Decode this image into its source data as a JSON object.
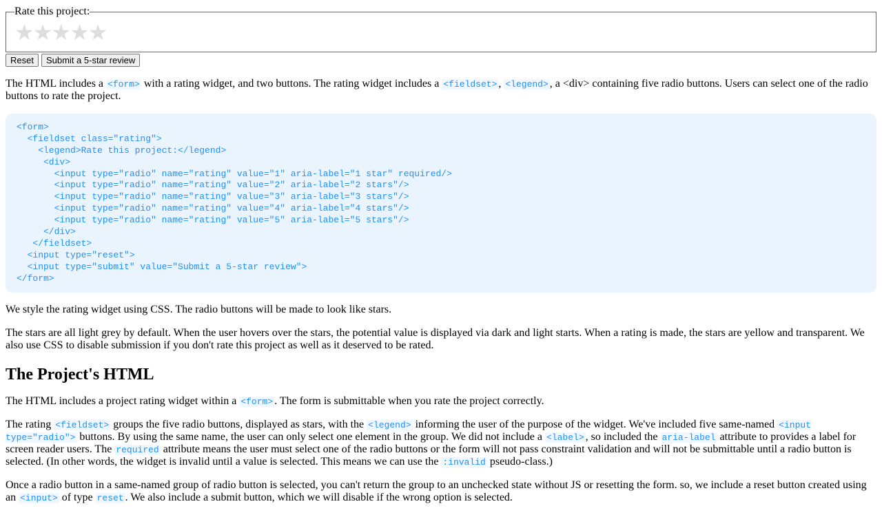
{
  "form": {
    "legend": "Rate this project:",
    "stars_display": "★★★★★",
    "reset_label": "Reset",
    "submit_label": "Submit a 5-star review"
  },
  "para1": {
    "t1": "The HTML includes a ",
    "c1": "<form>",
    "t2": " with a rating widget, and two buttons. The rating widget includes a ",
    "c2": "<fieldset>",
    "t3": ", ",
    "c3": "<legend>",
    "t4": ", a <div> containing five radio buttons. Users can select one of the radio buttons to rate the project."
  },
  "codeblock": "<form>\n  <fieldset class=\"rating\">\n    <legend>Rate this project:</legend>\n     <div>\n       <input type=\"radio\" name=\"rating\" value=\"1\" aria-label=\"1 star\" required/>\n       <input type=\"radio\" name=\"rating\" value=\"2\" aria-label=\"2 stars\"/>\n       <input type=\"radio\" name=\"rating\" value=\"3\" aria-label=\"3 stars\"/>\n       <input type=\"radio\" name=\"rating\" value=\"4\" aria-label=\"4 stars\"/>\n       <input type=\"radio\" name=\"rating\" value=\"5\" aria-label=\"5 stars\"/>\n     </div>\n   </fieldset>\n  <input type=\"reset\">\n  <input type=\"submit\" value=\"Submit a 5-star review\">\n</form>",
  "para2": "We style the rating widget using CSS. The radio buttons will be made to look like stars.",
  "para3": "The stars are all light grey by default. When the user hovers over the stars, the potential value is displayed via dark and light starts. When a rating is made, the stars are yellow and transparent. We also use CSS to disable submission if you don't rate this project as well as it deserved to be rated.",
  "heading": "The Project's HTML",
  "para4": {
    "t1": "The HTML includes a project rating widget within a ",
    "c1": "<form>",
    "t2": ". The form is submittable when you rate the project correctly."
  },
  "para5": {
    "t1": "The rating ",
    "c1": "<fieldset>",
    "t2": " groups the five radio buttons, displayed as stars, with the ",
    "c2": "<legend>",
    "t3": " informing the user of the purpose of the widget. We've included five same-named ",
    "c3": "<input type=\"radio\">",
    "t4": " buttons. By using the same name, the user can only select one element in the group. We did not include a ",
    "c4": "<label>",
    "t5": ", so included the ",
    "c5": "aria-label",
    "t6": " attribute to provides a label for screen reader users. The ",
    "c6": "required",
    "t7": " attribute means the user must select one of the radio buttons or the form will not pass constraint validation and will not be submittable until a radio button is selected. (In other words, the widget is invalid until a value is selected. This means we can use the ",
    "c7": ":invalid",
    "t8": " pseudo-class.)"
  },
  "para6": {
    "t1": "Once a radio button in a same-named group of radio button is selected, you can't return the group to an unchecked state without JS or resetting the form. so, we include a reset button created using an ",
    "c1": "<input>",
    "t2": " of type ",
    "c2": "reset",
    "t3": ". We also include a submit button, which we will disable if the wrong option is selected."
  }
}
